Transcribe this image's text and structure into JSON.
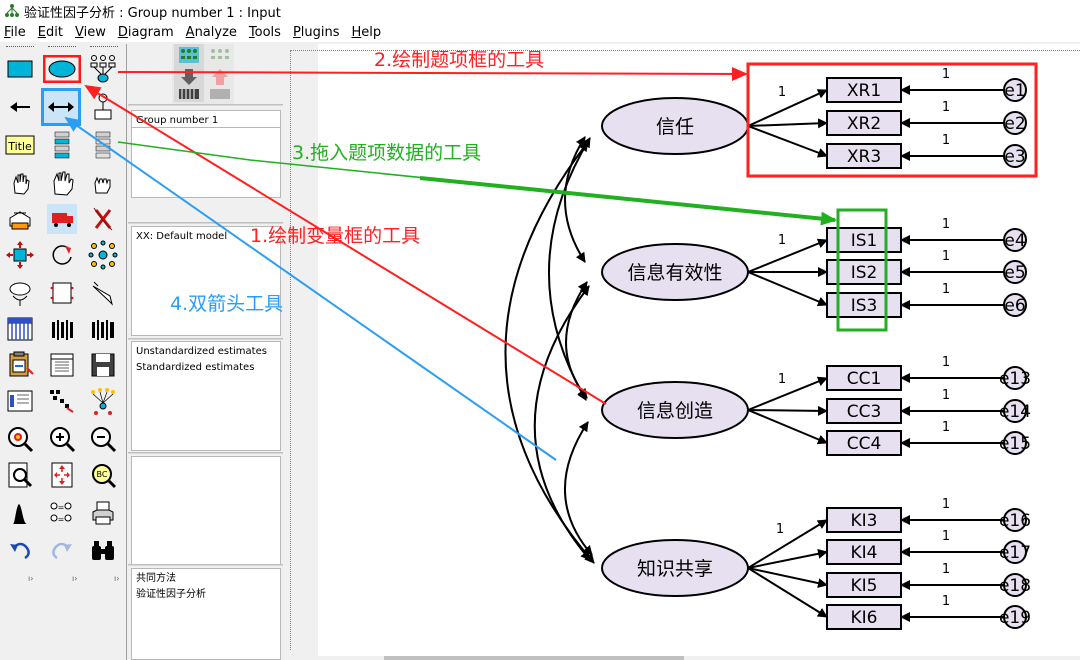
{
  "window": {
    "title": "验证性因子分析 : Group number 1 : Input"
  },
  "menu": [
    {
      "label": "File",
      "key": "F",
      "rest": "ile"
    },
    {
      "label": "Edit",
      "key": "E",
      "rest": "dit"
    },
    {
      "label": "View",
      "key": "V",
      "rest": "iew"
    },
    {
      "label": "Diagram",
      "key": "D",
      "rest": "iagram"
    },
    {
      "label": "Analyze",
      "key": "A",
      "rest": "nalyze"
    },
    {
      "label": "Tools",
      "key": "T",
      "rest": "ools"
    },
    {
      "label": "Plugins",
      "key": "P",
      "rest": "lugins"
    },
    {
      "label": "Help",
      "key": "H",
      "rest": "elp"
    }
  ],
  "toolbox": {
    "title_tool_label": "Title"
  },
  "panel": {
    "group": "Group number 1",
    "model": "XX: Default model",
    "estimates": [
      "Unstandardized estimates",
      "Standardized estimates"
    ],
    "files": [
      "共同方法",
      "验证性因子分析"
    ]
  },
  "annotations": [
    {
      "id": "a1",
      "text": "1.绘制变量框的工具",
      "color": "#ff2020"
    },
    {
      "id": "a2",
      "text": "2.绘制题项框的工具",
      "color": "#ff2020"
    },
    {
      "id": "a3",
      "text": "3.拖入题项数据的工具",
      "color": "#20b020"
    },
    {
      "id": "a4",
      "text": "4.双箭头工具",
      "color": "#2a9df4"
    }
  ],
  "diagram": {
    "latent": [
      {
        "id": "trust",
        "label": "信任"
      },
      {
        "id": "info_valid",
        "label": "信息有效性"
      },
      {
        "id": "info_create",
        "label": "信息创造"
      },
      {
        "id": "knowledge",
        "label": "知识共享"
      }
    ],
    "observed": [
      {
        "label": "XR1",
        "error": "e1",
        "factor": "trust"
      },
      {
        "label": "XR2",
        "error": "e2",
        "factor": "trust"
      },
      {
        "label": "XR3",
        "error": "e3",
        "factor": "trust"
      },
      {
        "label": "IS1",
        "error": "e4",
        "factor": "info_valid"
      },
      {
        "label": "IS2",
        "error": "e5",
        "factor": "info_valid"
      },
      {
        "label": "IS3",
        "error": "e6",
        "factor": "info_valid"
      },
      {
        "label": "CC1",
        "error": "e13",
        "factor": "info_create"
      },
      {
        "label": "CC3",
        "error": "e14",
        "factor": "info_create"
      },
      {
        "label": "CC4",
        "error": "e15",
        "factor": "info_create"
      },
      {
        "label": "KI3",
        "error": "e16",
        "factor": "knowledge"
      },
      {
        "label": "KI4",
        "error": "e17",
        "factor": "knowledge"
      },
      {
        "label": "KI5",
        "error": "e18",
        "factor": "knowledge"
      },
      {
        "label": "KI6",
        "error": "e19",
        "factor": "knowledge"
      }
    ],
    "fixed_loading": "1",
    "fixed_error": "1"
  },
  "colors": {
    "latent_fill": "#e6e0f0",
    "observed_fill": "#e6e0f0",
    "error_fill": "#e6e0f0",
    "selected_tool": "#cce4f7",
    "red": "#ff2020",
    "green": "#20b020",
    "blue": "#2a9df4"
  }
}
